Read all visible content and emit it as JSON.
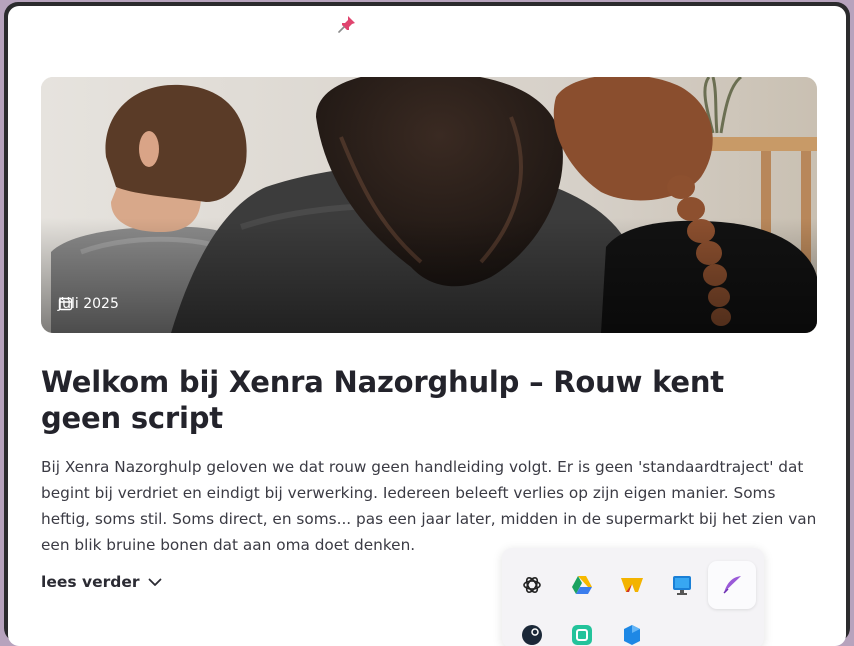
{
  "post": {
    "date": "Juli 2025",
    "title": "Welkom bij Xenra Nazorghulp – Rouw kent geen script",
    "body": "Bij Xenra Nazorghulp geloven we dat rouw geen handleiding volgt. Er is geen 'standaardtraject' dat begint bij verdriet en eindigt bij verwerking. Iedereen beleeft verlies op zijn eigen manier. Soms heftig, soms stil. Soms direct, en soms... pas een jaar later, midden in de supermarkt bij het zien van een blik bruine bonen dat aan oma doet denken.",
    "read_more": "lees verder"
  },
  "dock": {
    "row1": [
      "chatgpt-icon",
      "google-drive-icon",
      "wps-icon",
      "remote-desktop-icon",
      "quill-icon"
    ],
    "row2": [
      "steam-icon",
      "app-green-icon",
      "app-blue-icon"
    ]
  },
  "colors": {
    "title": "#23232b",
    "body": "#3b3b44",
    "pin": "#e0456f"
  }
}
